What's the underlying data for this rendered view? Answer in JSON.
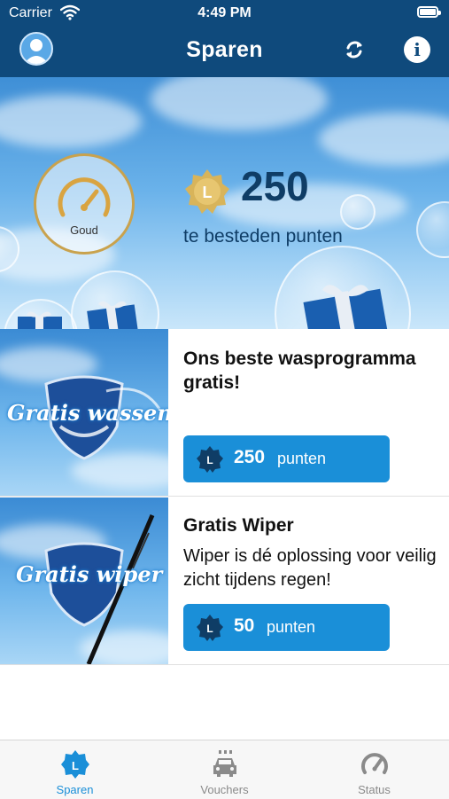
{
  "status_bar": {
    "carrier": "Carrier",
    "time": "4:49 PM"
  },
  "header": {
    "title": "Sparen",
    "icons": [
      "avatar",
      "refresh-icon",
      "info-icon"
    ],
    "info_glyph": "i"
  },
  "summary": {
    "level": "Goud",
    "badge_letter": "L",
    "points": "250",
    "points_label": "te besteden punten"
  },
  "rewards": [
    {
      "image_text": "Gratis wassen",
      "title": "Ons beste wasprogramma gratis!",
      "description": "",
      "cost": "250",
      "cost_unit": "punten"
    },
    {
      "image_text": "Gratis wiper",
      "title": "Gratis Wiper",
      "description": "Wiper is dé oplossing voor veilig zicht tijdens regen!",
      "cost": "50",
      "cost_unit": "punten"
    }
  ],
  "tabs": [
    {
      "label": "Sparen",
      "icon": "loyalty-badge-icon",
      "active": true
    },
    {
      "label": "Vouchers",
      "icon": "car-wash-icon",
      "active": false
    },
    {
      "label": "Status",
      "icon": "gauge-icon",
      "active": false
    }
  ],
  "colors": {
    "header": "#0f4a7c",
    "accent": "#1a8fd8",
    "gold": "#c9a24d",
    "tab_inactive": "#8a8a8a"
  }
}
